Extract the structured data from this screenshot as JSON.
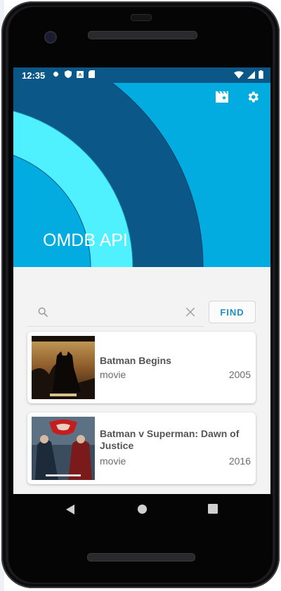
{
  "status_bar": {
    "time": "12:35",
    "icons": [
      "gear-icon",
      "shield-icon",
      "a-icon",
      "sd-card-icon"
    ],
    "right_icons": [
      "wifi-icon",
      "signal-icon",
      "battery-icon"
    ]
  },
  "header": {
    "title": "OMDB API",
    "actions": [
      "movie-filter-icon",
      "settings-icon"
    ],
    "colors": {
      "background": "#02ace0",
      "band_dark": "#0b5788",
      "band_light": "#4ff0ff",
      "inner": "#02ace0"
    }
  },
  "search": {
    "placeholder": "",
    "value": "",
    "find_label": "FIND"
  },
  "results": [
    {
      "title": "Batman Begins",
      "type": "movie",
      "year": "2005"
    },
    {
      "title": "Batman v Superman: Dawn of Justice",
      "type": "movie",
      "year": "2016"
    }
  ],
  "navigation": {
    "buttons": [
      "back-icon",
      "home-icon",
      "overview-icon"
    ]
  }
}
